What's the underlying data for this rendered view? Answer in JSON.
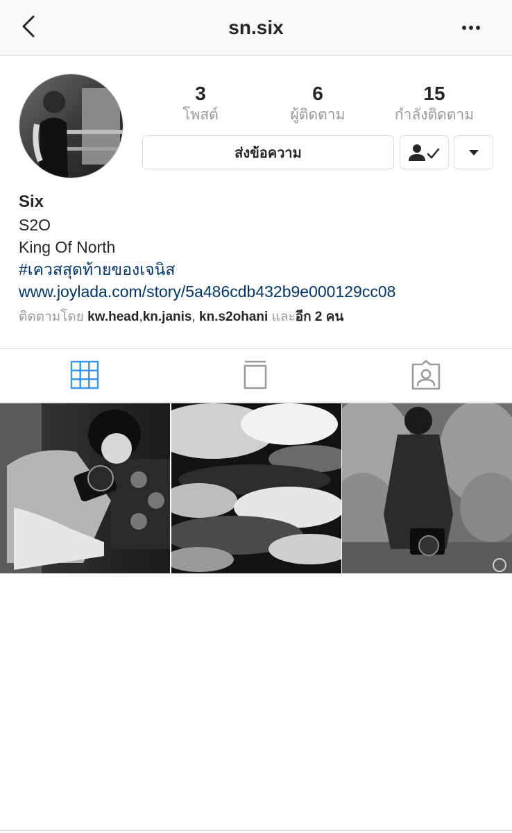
{
  "header": {
    "title": "sn.six",
    "back_icon": "chevron-left-icon",
    "more_icon": "more-horizontal-icon"
  },
  "profile": {
    "stats": [
      {
        "value": "3",
        "label": "โพสต์"
      },
      {
        "value": "6",
        "label": "ผู้ติดตาม"
      },
      {
        "value": "15",
        "label": "กำลังติดตาม"
      }
    ],
    "message_label": "ส่งข้อความ",
    "following_icon": "user-check-icon",
    "dropdown_icon": "triangle-down-icon"
  },
  "bio": {
    "name": "Six",
    "line1": "S2O",
    "line2": "King Of North",
    "hashtag": "#เควสสุดท้ายของเจนิส",
    "link": "www.joylada.com/story/5a486cdb432b9e000129cc08",
    "followed_by_prefix": "ติดตามโดย ",
    "followed_by_user1": "kw.head",
    "sep1": ",",
    "followed_by_user2": "kn.janis",
    "sep2": ", ",
    "followed_by_user3": "kn.s2ohani",
    "followed_by_and": " และ",
    "followed_by_more": "อีก 2 คน"
  },
  "tabs": [
    {
      "name": "grid",
      "icon": "grid-icon",
      "active": true
    },
    {
      "name": "feed",
      "icon": "feed-icon",
      "active": false
    },
    {
      "name": "tagged",
      "icon": "tagged-person-icon",
      "active": false
    }
  ],
  "colors": {
    "accent": "#3897f0",
    "link": "#003569",
    "muted": "#999999",
    "border": "#dbdbdb"
  },
  "posts": [
    {
      "subject": "dumbbell workout photo"
    },
    {
      "subject": "clouds sky photo"
    },
    {
      "subject": "person with camera in smoke photo"
    }
  ]
}
